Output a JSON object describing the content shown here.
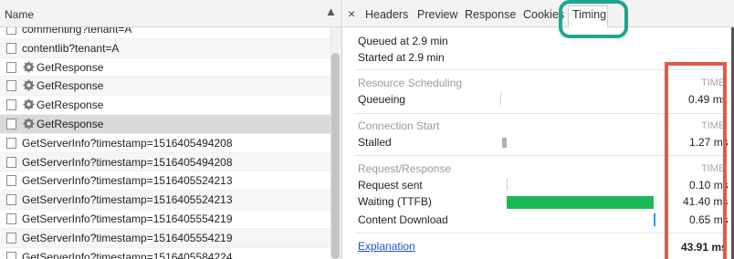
{
  "left": {
    "column_header": "Name",
    "requests": [
      {
        "name": "commenting?tenant=A",
        "icon": null
      },
      {
        "name": "contentlib?tenant=A",
        "icon": null
      },
      {
        "name": "GetResponse",
        "icon": "gear-icon"
      },
      {
        "name": "GetResponse",
        "icon": "gear-icon"
      },
      {
        "name": "GetResponse",
        "icon": "gear-icon"
      },
      {
        "name": "GetResponse",
        "icon": "gear-icon",
        "selected": true
      },
      {
        "name": "GetServerInfo?timestamp=1516405494208",
        "icon": null
      },
      {
        "name": "GetServerInfo?timestamp=1516405494208",
        "icon": null
      },
      {
        "name": "GetServerInfo?timestamp=1516405524213",
        "icon": null
      },
      {
        "name": "GetServerInfo?timestamp=1516405524213",
        "icon": null
      },
      {
        "name": "GetServerInfo?timestamp=1516405554219",
        "icon": null
      },
      {
        "name": "GetServerInfo?timestamp=1516405554219",
        "icon": null
      },
      {
        "name": "GetServerInfo?timestamp=1516405584224",
        "icon": null
      }
    ]
  },
  "tabs": {
    "close": "×",
    "items": [
      "Headers",
      "Preview",
      "Response",
      "Cookies",
      "Timing"
    ],
    "active": "Timing"
  },
  "timing": {
    "queued_at": "Queued at 2.9 min",
    "started_at": "Started at 2.9 min",
    "time_header": "TIME",
    "sections": [
      {
        "title": "Resource Scheduling",
        "rows": [
          {
            "label": "Queueing",
            "value": "0.49 ms"
          }
        ]
      },
      {
        "title": "Connection Start",
        "rows": [
          {
            "label": "Stalled",
            "value": "1.27 ms"
          }
        ]
      },
      {
        "title": "Request/Response",
        "rows": [
          {
            "label": "Request sent",
            "value": "0.10 ms"
          },
          {
            "label": "Waiting (TTFB)",
            "value": "41.40 ms"
          },
          {
            "label": "Content Download",
            "value": "0.65 ms"
          }
        ]
      }
    ],
    "explanation": "Explanation",
    "total": "43.91 ms"
  },
  "colors": {
    "waiting_bar": "#1db954",
    "download_bar": "#2a9df4",
    "stalled_bar": "#b0b0b0",
    "timing_tab_highlight": "#1fa58f",
    "time_column_highlight": "#e05a4c",
    "link": "#1a57c9"
  }
}
